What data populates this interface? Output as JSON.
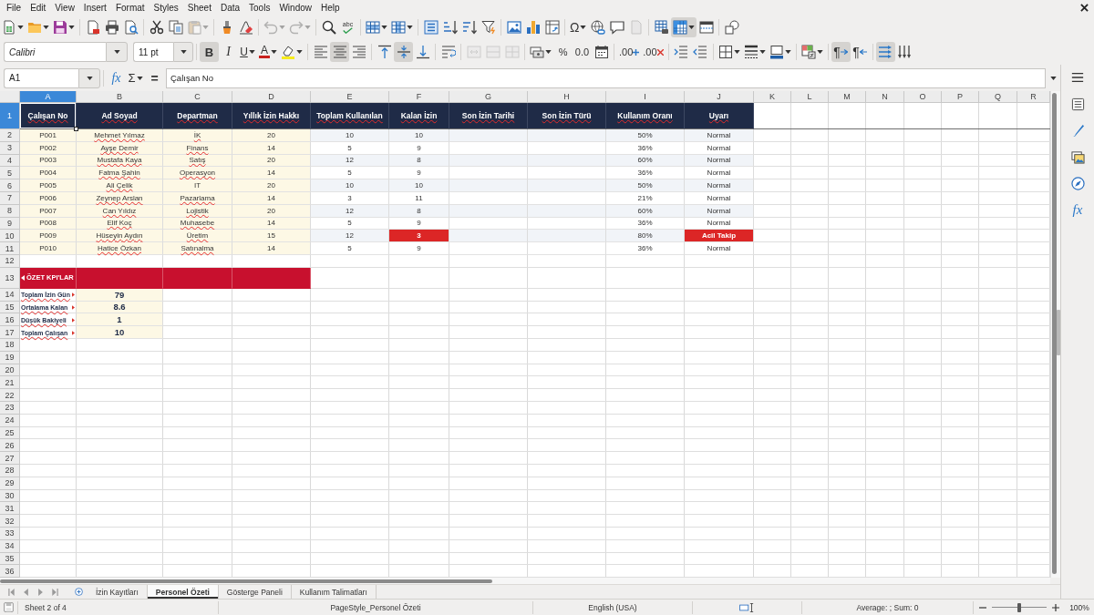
{
  "menu_bar": {
    "items": [
      "File",
      "Edit",
      "View",
      "Insert",
      "Format",
      "Styles",
      "Sheet",
      "Data",
      "Tools",
      "Window",
      "Help"
    ]
  },
  "standard_toolbar": {
    "paste": {
      "disabled": true
    },
    "undo": {
      "disabled": true
    },
    "redo": {
      "disabled": true
    },
    "spelling_glyph": "abc",
    "special_character_glyph": "Ω",
    "headers_footers": {
      "disabled": true
    },
    "freeze_rows_columns": {
      "pressed": true
    }
  },
  "formatting_toolbar": {
    "font_name": "Calibri",
    "font_size": "11 pt",
    "bold": {
      "glyph": "B",
      "pressed": true
    },
    "italic": {
      "glyph": "I",
      "pressed": false
    },
    "underline": {
      "glyph": "U",
      "pressed": false
    },
    "font_color_glyph": "A",
    "align_left": {
      "pressed": false
    },
    "align_center": {
      "pressed": true
    },
    "align_right": {
      "pressed": false
    },
    "align_top": {
      "pressed": false
    },
    "center_vertically": {
      "pressed": true
    },
    "align_bottom": {
      "pressed": false
    },
    "merge_and_center": {
      "disabled": true
    },
    "merge_cells": {
      "disabled": true
    },
    "unmerge_cells": {
      "disabled": true
    },
    "percent_glyph": "%",
    "number_glyph": "0.0",
    "add_decimal_glyph": ".00",
    "delete_decimal_glyph": ".00",
    "left_to_right": {
      "glyph": "¶",
      "pressed": true
    },
    "right_to_left": {
      "glyph": "¶",
      "pressed": false
    },
    "text_left_to_right": {
      "pressed": true
    },
    "text_top_to_bottom": {
      "pressed": false
    }
  },
  "formula_bar": {
    "name_box": "A1",
    "function_wizard_glyph": "fx",
    "sum_glyph": "Σ",
    "equals_glyph": "=",
    "content": "Çalışan No"
  },
  "sidebar": {
    "functions_glyph": "fx"
  },
  "sheet": {
    "columns": [
      {
        "label": "A",
        "selected": true
      },
      {
        "label": "B",
        "selected": false
      },
      {
        "label": "C",
        "selected": false
      },
      {
        "label": "D",
        "selected": false
      },
      {
        "label": "E",
        "selected": false
      },
      {
        "label": "F",
        "selected": false
      },
      {
        "label": "G",
        "selected": false
      },
      {
        "label": "H",
        "selected": false
      },
      {
        "label": "I",
        "selected": false
      },
      {
        "label": "J",
        "selected": false
      },
      {
        "label": "K",
        "selected": false
      },
      {
        "label": "L",
        "selected": false
      },
      {
        "label": "M",
        "selected": false
      },
      {
        "label": "N",
        "selected": false
      },
      {
        "label": "O",
        "selected": false
      },
      {
        "label": "P",
        "selected": false
      },
      {
        "label": "Q",
        "selected": false
      },
      {
        "label": "R",
        "selected": false
      }
    ],
    "row_numbers": [
      {
        "label": "1",
        "selected": true
      },
      {
        "label": "2",
        "selected": false
      },
      {
        "label": "3",
        "selected": false
      },
      {
        "label": "4",
        "selected": false
      },
      {
        "label": "5",
        "selected": false
      },
      {
        "label": "6",
        "selected": false
      },
      {
        "label": "7",
        "selected": false
      },
      {
        "label": "8",
        "selected": false
      },
      {
        "label": "9",
        "selected": false
      },
      {
        "label": "10",
        "selected": false
      },
      {
        "label": "11",
        "selected": false
      },
      {
        "label": "12",
        "selected": false
      },
      {
        "label": "13",
        "selected": false
      },
      {
        "label": "14",
        "selected": false
      },
      {
        "label": "15",
        "selected": false
      },
      {
        "label": "16",
        "selected": false
      },
      {
        "label": "17",
        "selected": false
      },
      {
        "label": "18",
        "selected": false
      },
      {
        "label": "19",
        "selected": false
      },
      {
        "label": "20",
        "selected": false
      },
      {
        "label": "21",
        "selected": false
      },
      {
        "label": "22",
        "selected": false
      },
      {
        "label": "23",
        "selected": false
      },
      {
        "label": "24",
        "selected": false
      },
      {
        "label": "25",
        "selected": false
      },
      {
        "label": "26",
        "selected": false
      },
      {
        "label": "27",
        "selected": false
      },
      {
        "label": "28",
        "selected": false
      },
      {
        "label": "29",
        "selected": false
      },
      {
        "label": "30",
        "selected": false
      },
      {
        "label": "31",
        "selected": false
      },
      {
        "label": "32",
        "selected": false
      },
      {
        "label": "33",
        "selected": false
      },
      {
        "label": "34",
        "selected": false
      },
      {
        "label": "35",
        "selected": false
      },
      {
        "label": "36",
        "selected": false
      }
    ],
    "header_row": [
      {
        "text": "Çalışan No",
        "misspelled": true
      },
      {
        "text": "Ad Soyad",
        "misspelled": true
      },
      {
        "text": "Departman",
        "misspelled": true
      },
      {
        "text": "Yıllık İzin Hakkı",
        "misspelled": true
      },
      {
        "text": "Toplam Kullanılan",
        "misspelled": true
      },
      {
        "text": "Kalan İzin",
        "misspelled": true
      },
      {
        "text": "Son İzin Tarihi",
        "misspelled": true
      },
      {
        "text": "Son İzin Türü",
        "misspelled": true
      },
      {
        "text": "Kullanım Oranı",
        "misspelled": true
      },
      {
        "text": "Uyarı",
        "misspelled": true
      }
    ],
    "records": [
      {
        "employee_no": "P001",
        "name": "Mehmet Yılmaz",
        "name_misspelled": true,
        "department": "İK",
        "department_misspelled": true,
        "annual_entitlement": "20",
        "total_used": "10",
        "remaining": "10",
        "remaining_low": false,
        "usage_rate": "50%",
        "warning": "Normal",
        "warning_urgent": false
      },
      {
        "employee_no": "P002",
        "name": "Ayşe Demir",
        "name_misspelled": true,
        "department": "Finans",
        "department_misspelled": true,
        "annual_entitlement": "14",
        "total_used": "5",
        "remaining": "9",
        "remaining_low": false,
        "usage_rate": "36%",
        "warning": "Normal",
        "warning_urgent": false
      },
      {
        "employee_no": "P003",
        "name": "Mustafa Kaya",
        "name_misspelled": true,
        "department": "Satış",
        "department_misspelled": true,
        "annual_entitlement": "20",
        "total_used": "12",
        "remaining": "8",
        "remaining_low": false,
        "usage_rate": "60%",
        "warning": "Normal",
        "warning_urgent": false
      },
      {
        "employee_no": "P004",
        "name": "Fatma Şahin",
        "name_misspelled": true,
        "department": "Operasyon",
        "department_misspelled": true,
        "annual_entitlement": "14",
        "total_used": "5",
        "remaining": "9",
        "remaining_low": false,
        "usage_rate": "36%",
        "warning": "Normal",
        "warning_urgent": false
      },
      {
        "employee_no": "P005",
        "name": "Ali Çelik",
        "name_misspelled": true,
        "department": "IT",
        "department_misspelled": false,
        "annual_entitlement": "20",
        "total_used": "10",
        "remaining": "10",
        "remaining_low": false,
        "usage_rate": "50%",
        "warning": "Normal",
        "warning_urgent": false
      },
      {
        "employee_no": "P006",
        "name": "Zeynep Arslan",
        "name_misspelled": true,
        "department": "Pazarlama",
        "department_misspelled": true,
        "annual_entitlement": "14",
        "total_used": "3",
        "remaining": "11",
        "remaining_low": false,
        "usage_rate": "21%",
        "warning": "Normal",
        "warning_urgent": false
      },
      {
        "employee_no": "P007",
        "name": "Can Yıldız",
        "name_misspelled": true,
        "department": "Lojistik",
        "department_misspelled": true,
        "annual_entitlement": "20",
        "total_used": "12",
        "remaining": "8",
        "remaining_low": false,
        "usage_rate": "60%",
        "warning": "Normal",
        "warning_urgent": false
      },
      {
        "employee_no": "P008",
        "name": "Elif Koç",
        "name_misspelled": true,
        "department": "Muhasebe",
        "department_misspelled": true,
        "annual_entitlement": "14",
        "total_used": "5",
        "remaining": "9",
        "remaining_low": false,
        "usage_rate": "36%",
        "warning": "Normal",
        "warning_urgent": false
      },
      {
        "employee_no": "P009",
        "name": "Hüseyin Aydın",
        "name_misspelled": true,
        "department": "Üretim",
        "department_misspelled": true,
        "annual_entitlement": "15",
        "total_used": "12",
        "remaining": "3",
        "remaining_low": true,
        "usage_rate": "80%",
        "warning": "Acil Takip",
        "warning_urgent": true
      },
      {
        "employee_no": "P010",
        "name": "Hatice Özkan",
        "name_misspelled": true,
        "department": "Satınalma",
        "department_misspelled": true,
        "annual_entitlement": "14",
        "total_used": "5",
        "remaining": "9",
        "remaining_low": false,
        "usage_rate": "36%",
        "warning": "Normal",
        "warning_urgent": false
      }
    ],
    "kpi_title": "ÖZET KPI'LAR",
    "kpis": [
      {
        "label": "Toplam İzin Gün",
        "value": "79",
        "misspelled": true
      },
      {
        "label": "Ortalama Kalan",
        "value": "8.6",
        "misspelled": true
      },
      {
        "label": "Düşük Bakiyeli",
        "value": "1",
        "misspelled": true
      },
      {
        "label": "Toplam Çalışan",
        "value": "10",
        "misspelled": true
      }
    ]
  },
  "sheet_tabs": [
    {
      "label": "İzin Kayıtları",
      "selected": false
    },
    {
      "label": "Personel Özeti",
      "selected": true
    },
    {
      "label": "Gösterge Paneli",
      "selected": false
    },
    {
      "label": "Kullanım Talimatları",
      "selected": false
    }
  ],
  "status_bar": {
    "sheet_position": "Sheet 2 of 4",
    "page_style": "PageStyle_Personel Özeti",
    "language": "English (USA)",
    "selection_summary": "Average: ; Sum: 0",
    "zoom": {
      "level": 0.5,
      "reading": "100%"
    }
  }
}
